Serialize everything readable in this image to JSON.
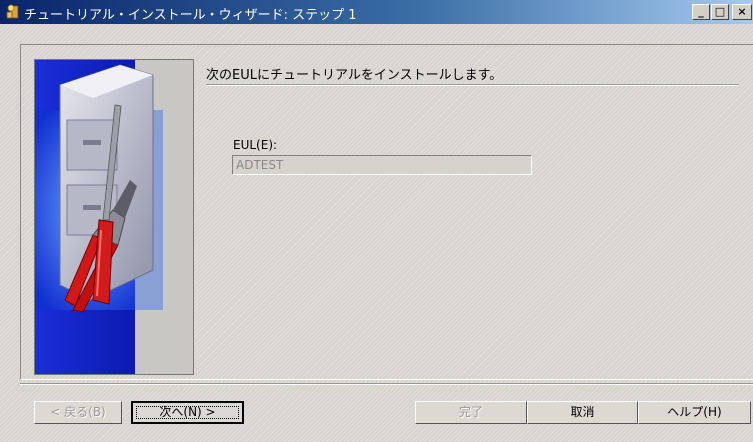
{
  "window": {
    "title": "チュートリアル・インストール・ウィザード: ステップ 1",
    "controls": {
      "minimize": "_",
      "maximize": "□",
      "close": "×"
    }
  },
  "main": {
    "heading": "次のEULにチュートリアルをインストールします。",
    "eul_label": "EUL(E):",
    "eul_value": "ADTEST"
  },
  "buttons": {
    "back": "< 戻る(B)",
    "next": "次へ(N) >",
    "finish": "完了",
    "cancel": "取消",
    "help": "ヘルプ(H)"
  },
  "icons": [
    "wizard-app-icon",
    "wizard-banner-image"
  ]
}
